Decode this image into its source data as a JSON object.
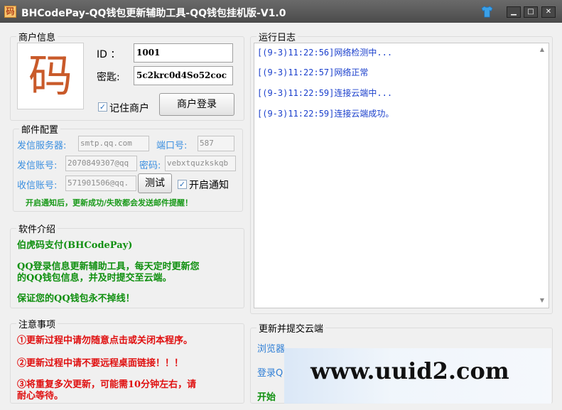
{
  "window": {
    "title": "BHCodePay-QQ钱包更新辅助工具-QQ钱包挂机版-V1.0",
    "app_icon_glyph": "码",
    "icons": [
      "app-icon",
      "skin-shirt-icon",
      "minimize-icon",
      "maximize-icon",
      "close-icon"
    ],
    "controls": {
      "minimize": "▁",
      "maximize": "□",
      "close": "✕"
    }
  },
  "merchant": {
    "group_label": "商户信息",
    "logo_glyph": "码",
    "id_label": "ID ：",
    "id_value": "1001",
    "key_label": "密匙:",
    "key_value": "5c2krc0d4So52coc",
    "remember_checked": true,
    "remember_label": "记住商户",
    "login_button": "商户登录"
  },
  "mail": {
    "group_label": "邮件配置",
    "server_label": "发信服务器:",
    "server_value": "smtp.qq.com",
    "port_label": "端口号:",
    "port_value": "587",
    "sender_label": "发信账号:",
    "sender_value": "2070849307@qq",
    "password_label": "密码:",
    "password_value": "vebxtquzkskqb",
    "receiver_label": "收信账号:",
    "receiver_value": "571901506@qq.",
    "test_button": "测试",
    "notify_checked": true,
    "notify_label": "开启通知",
    "note": "开启通知后，更新成功/失败都会发送邮件提醒！"
  },
  "intro": {
    "group_label": "软件介绍",
    "line1": "伯虎码支付(BHCodePay)",
    "line2": "QQ登录信息更新辅助工具，每天定时更新您",
    "line3": "的QQ钱包信息，并及时提交至云端。",
    "line4": "保证您的QQ钱包永不掉线！"
  },
  "notice": {
    "group_label": "注意事项",
    "item1": "①更新过程中请勿随意点击或关闭本程序。",
    "item2": "②更新过程中请不要远程桌面链接！！！",
    "item3a": "③将重复多次更新，可能需10分钟左右，请",
    "item3b": "耐心等待。"
  },
  "log": {
    "group_label": "运行日志",
    "lines": [
      "[(9-3)11:22:56]网络检测中...",
      "[(9-3)11:22:57]网络正常",
      "[(9-3)11:22:59]连接云端中...",
      "[(9-3)11:22:59]连接云端成功。"
    ]
  },
  "update": {
    "group_label": "更新并提交云端",
    "browser_label": "浏览器",
    "login_label": "登录Q",
    "start_label": "开始"
  },
  "watermark": "www.uuid2.com",
  "colors": {
    "titlebar": "#555555",
    "label_blue": "#3b8fe0",
    "log_blue": "#1a3fcc",
    "note_green": "#1a9a1a",
    "notice_red": "#e01010"
  }
}
